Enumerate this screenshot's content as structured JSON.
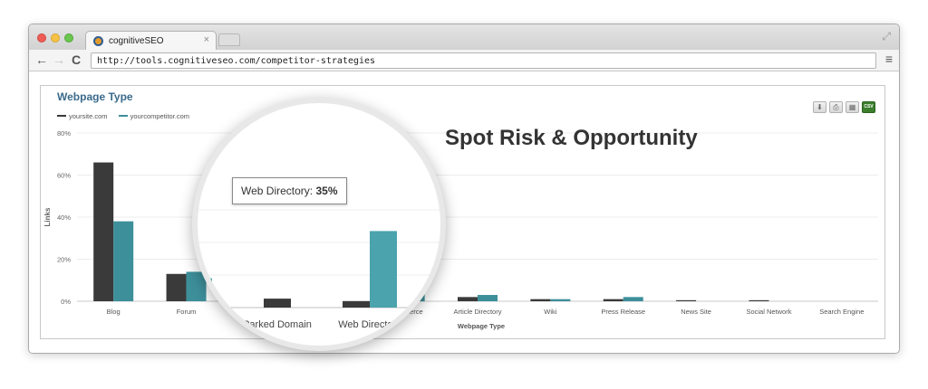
{
  "browser": {
    "tab_title": "cognitiveSEO",
    "tab_close": "×",
    "url": "http://tools.cognitiveseo.com/competitor-strategies",
    "back_icon": "←",
    "forward_icon": "→",
    "reload_icon": "C",
    "menu_icon": "≡",
    "fullscreen_icon": "⤢"
  },
  "panel": {
    "title": "Webpage Type",
    "headline": "Spot Risk & Opportunity",
    "export_icons": [
      "download-icon",
      "print-icon",
      "table-icon",
      "csv-icon"
    ],
    "csv_label": "CSV"
  },
  "tooltip": {
    "label": "Web Directory:",
    "value": "35%"
  },
  "colors": {
    "yoursite": "#3a3a3a",
    "competitor": "#3d8f9a",
    "competitor_zoom": "#4aa3ad"
  },
  "chart_data": {
    "type": "bar",
    "xlabel": "Webpage Type",
    "ylabel": "Links",
    "ylim": [
      0,
      80
    ],
    "yticks": [
      "0%",
      "20%",
      "40%",
      "60%",
      "80%"
    ],
    "ytick_values": [
      0,
      20,
      40,
      60,
      80
    ],
    "categories": [
      "Blog",
      "Forum",
      "Parked Domain",
      "Web Directory",
      "Ecommerce",
      "Article Directory",
      "Wiki",
      "Press Release",
      "News Site",
      "Social Network",
      "Search Engine"
    ],
    "series": [
      {
        "name": "yoursite.com",
        "values": [
          66,
          13,
          5.5,
          4,
          3,
          2,
          1,
          1,
          0.5,
          0.5,
          0
        ]
      },
      {
        "name": "yourcompetitor.com",
        "values": [
          38,
          14,
          0,
          47,
          6,
          3,
          1,
          2,
          0,
          0,
          0
        ]
      }
    ],
    "magnified": {
      "categories": [
        "Parked Domain",
        "Web Directory"
      ],
      "series_values": [
        [
          5.5,
          4
        ],
        [
          0,
          47
        ]
      ]
    },
    "grid": true,
    "legend": "top-left"
  }
}
